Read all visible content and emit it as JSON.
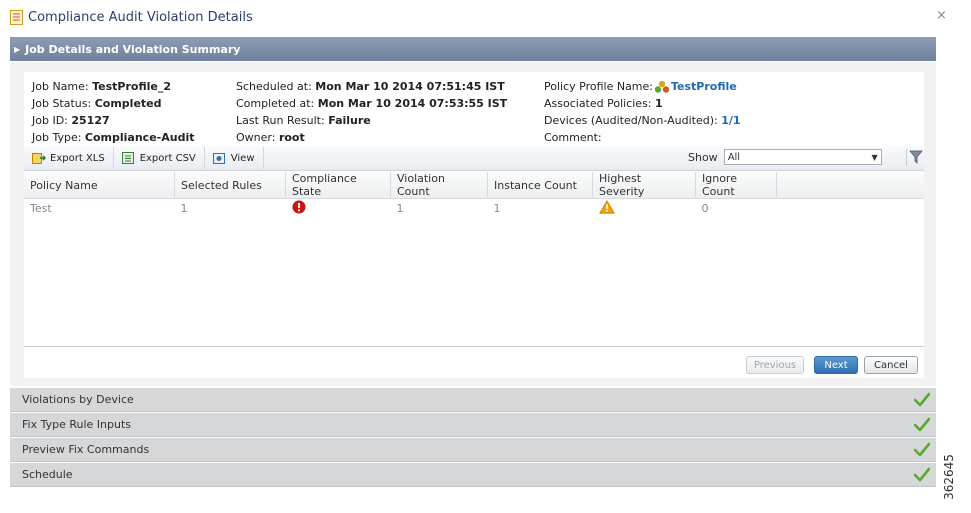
{
  "dialog": {
    "title": "Compliance Audit Violation Details",
    "close": "×"
  },
  "summary_header": "Job Details and Violation Summary",
  "job": {
    "name_label": "Job Name: ",
    "name": "TestProfile_2",
    "status_label": "Job Status: ",
    "status": "Completed",
    "id_label": "Job ID: ",
    "id": "25127",
    "type_label": "Job Type: ",
    "type": "Compliance-Audit",
    "scheduled_label": "Scheduled at: ",
    "scheduled": "Mon Mar 10 2014 07:51:45 IST",
    "completed_label": "Completed at: ",
    "completed": "Mon Mar 10 2014 07:53:55 IST",
    "last_run_label": "Last Run Result: ",
    "last_run": "Failure",
    "owner_label": "Owner: ",
    "owner": "root",
    "policy_profile_label": "Policy Profile Name: ",
    "policy_profile": "TestProfile",
    "associated_label": "Associated Policies: ",
    "associated": "1",
    "devices_label": "Devices (Audited/Non-Audited): ",
    "devices": "1/1",
    "comment_label": "Comment:"
  },
  "toolbar": {
    "export_xls": "Export XLS",
    "export_csv": "Export CSV",
    "view": "View",
    "show_label": "Show",
    "show_value": "All"
  },
  "table": {
    "columns": [
      "Policy Name",
      "Selected Rules",
      "Compliance State",
      "Violation Count",
      "Instance Count",
      "Highest Severity",
      "Ignore Count"
    ],
    "rows": [
      {
        "policy_name": "Test",
        "selected_rules": "1",
        "compliance_state": "error-icon",
        "violation_count": "1",
        "instance_count": "1",
        "highest_severity": "warning-icon",
        "ignore_count": "0"
      }
    ]
  },
  "buttons": {
    "previous": "Previous",
    "next": "Next",
    "cancel": "Cancel"
  },
  "sections": [
    {
      "label": "Violations by Device",
      "status": "check-icon"
    },
    {
      "label": "Fix Type Rule Inputs",
      "status": "check-icon"
    },
    {
      "label": "Preview Fix Commands",
      "status": "check-icon"
    },
    {
      "label": "Schedule",
      "status": "check-icon"
    }
  ],
  "figure_id": "362645",
  "colors": {
    "header": "#6f819d",
    "link": "#1e6ab0",
    "error": "#cc1111",
    "warning": "#f0a30a",
    "check": "#5aa832",
    "next_button": "#2f6fb0"
  }
}
